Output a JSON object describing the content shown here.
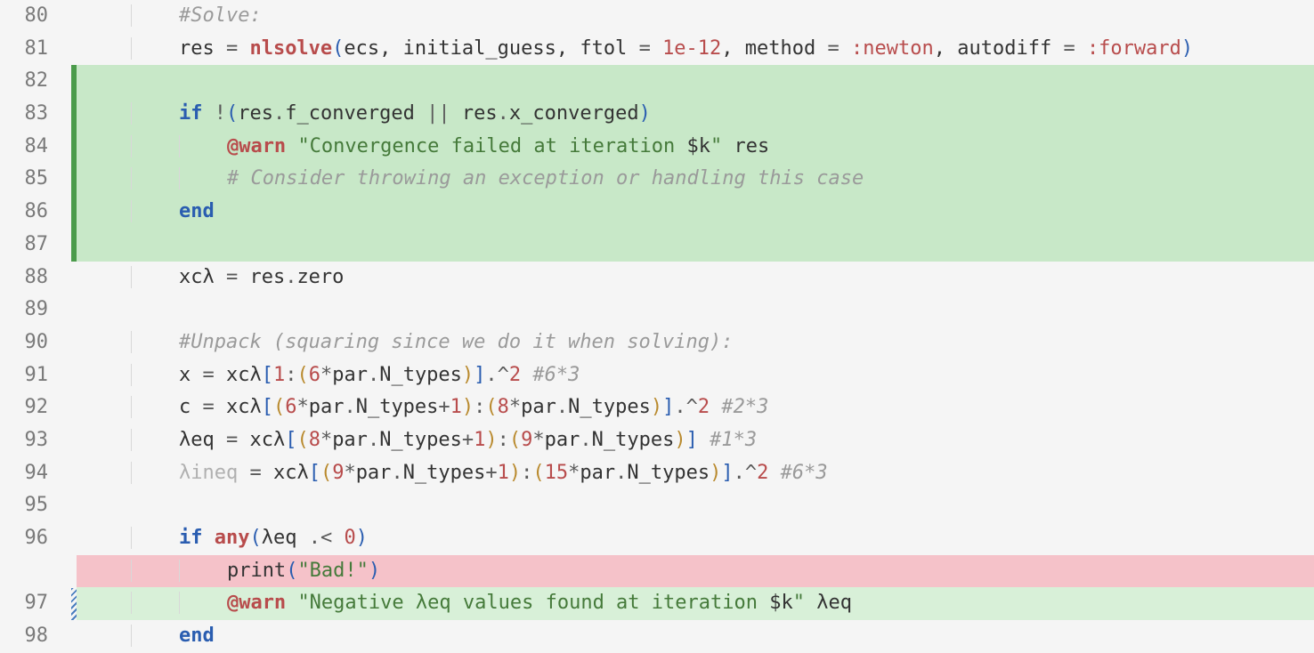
{
  "lines": [
    {
      "num": "80",
      "indent": 2,
      "bg": "",
      "tokens": [
        {
          "t": "#Solve:",
          "c": "c-comment"
        }
      ]
    },
    {
      "num": "81",
      "indent": 2,
      "bg": "",
      "tokens": [
        {
          "t": "res ",
          "c": "c-id"
        },
        {
          "t": "=",
          "c": "c-op"
        },
        {
          "t": " ",
          "c": ""
        },
        {
          "t": "nlsolve",
          "c": "c-fn"
        },
        {
          "t": "(",
          "c": "c-paren"
        },
        {
          "t": "ecs, initial_guess, ftol ",
          "c": "c-id"
        },
        {
          "t": "=",
          "c": "c-op"
        },
        {
          "t": " ",
          "c": ""
        },
        {
          "t": "1e-12",
          "c": "c-num"
        },
        {
          "t": ", method ",
          "c": "c-id"
        },
        {
          "t": "=",
          "c": "c-op"
        },
        {
          "t": " ",
          "c": ""
        },
        {
          "t": ":newton",
          "c": "c-sym"
        },
        {
          "t": ", autodiff ",
          "c": "c-id"
        },
        {
          "t": "=",
          "c": "c-op"
        },
        {
          "t": " ",
          "c": ""
        },
        {
          "t": ":forward",
          "c": "c-sym"
        },
        {
          "t": ")",
          "c": "c-paren"
        }
      ]
    },
    {
      "num": "82",
      "indent": 1,
      "bg": "bg-add",
      "tokens": []
    },
    {
      "num": "83",
      "indent": 2,
      "bg": "bg-add",
      "tokens": [
        {
          "t": "if",
          "c": "c-kw"
        },
        {
          "t": " ",
          "c": ""
        },
        {
          "t": "!",
          "c": "c-op"
        },
        {
          "t": "(",
          "c": "c-paren"
        },
        {
          "t": "res",
          "c": "c-id"
        },
        {
          "t": ".",
          "c": "c-op"
        },
        {
          "t": "f_converged ",
          "c": "c-id"
        },
        {
          "t": "||",
          "c": "c-op"
        },
        {
          "t": " res",
          "c": "c-id"
        },
        {
          "t": ".",
          "c": "c-op"
        },
        {
          "t": "x_converged",
          "c": "c-id"
        },
        {
          "t": ")",
          "c": "c-paren"
        }
      ]
    },
    {
      "num": "84",
      "indent": 3,
      "bg": "bg-add",
      "tokens": [
        {
          "t": "@warn",
          "c": "c-macro"
        },
        {
          "t": " ",
          "c": ""
        },
        {
          "t": "\"Convergence failed at iteration ",
          "c": "c-str"
        },
        {
          "t": "$k",
          "c": "c-id"
        },
        {
          "t": "\"",
          "c": "c-str"
        },
        {
          "t": " res",
          "c": "c-id"
        }
      ]
    },
    {
      "num": "85",
      "indent": 3,
      "bg": "bg-add",
      "tokens": [
        {
          "t": "# Consider throwing an exception or handling this case",
          "c": "c-comment"
        }
      ]
    },
    {
      "num": "86",
      "indent": 2,
      "bg": "bg-add",
      "tokens": [
        {
          "t": "end",
          "c": "c-kw"
        }
      ]
    },
    {
      "num": "87",
      "indent": 1,
      "bg": "bg-add",
      "tokens": []
    },
    {
      "num": "88",
      "indent": 2,
      "bg": "",
      "tokens": [
        {
          "t": "xcλ ",
          "c": "c-id"
        },
        {
          "t": "=",
          "c": "c-op"
        },
        {
          "t": " res",
          "c": "c-id"
        },
        {
          "t": ".",
          "c": "c-op"
        },
        {
          "t": "zero",
          "c": "c-id"
        }
      ]
    },
    {
      "num": "89",
      "indent": 1,
      "bg": "",
      "tokens": []
    },
    {
      "num": "90",
      "indent": 2,
      "bg": "",
      "tokens": [
        {
          "t": "#Unpack (squaring since we do it when solving):",
          "c": "c-comment"
        }
      ]
    },
    {
      "num": "91",
      "indent": 2,
      "bg": "",
      "tokens": [
        {
          "t": "x ",
          "c": "c-id"
        },
        {
          "t": "=",
          "c": "c-op"
        },
        {
          "t": " xcλ",
          "c": "c-id"
        },
        {
          "t": "[",
          "c": "c-paren"
        },
        {
          "t": "1",
          "c": "c-num"
        },
        {
          "t": ":",
          "c": "c-op"
        },
        {
          "t": "(",
          "c": "c-brack-o"
        },
        {
          "t": "6",
          "c": "c-num"
        },
        {
          "t": "*",
          "c": "c-op"
        },
        {
          "t": "par",
          "c": "c-id"
        },
        {
          "t": ".",
          "c": "c-op"
        },
        {
          "t": "N_types",
          "c": "c-id"
        },
        {
          "t": ")",
          "c": "c-brack-o"
        },
        {
          "t": "]",
          "c": "c-paren"
        },
        {
          "t": ".^",
          "c": "c-op"
        },
        {
          "t": "2",
          "c": "c-num"
        },
        {
          "t": " ",
          "c": ""
        },
        {
          "t": "#6*3",
          "c": "c-comment"
        }
      ]
    },
    {
      "num": "92",
      "indent": 2,
      "bg": "",
      "tokens": [
        {
          "t": "c ",
          "c": "c-id"
        },
        {
          "t": "=",
          "c": "c-op"
        },
        {
          "t": " xcλ",
          "c": "c-id"
        },
        {
          "t": "[",
          "c": "c-paren"
        },
        {
          "t": "(",
          "c": "c-brack-o"
        },
        {
          "t": "6",
          "c": "c-num"
        },
        {
          "t": "*",
          "c": "c-op"
        },
        {
          "t": "par",
          "c": "c-id"
        },
        {
          "t": ".",
          "c": "c-op"
        },
        {
          "t": "N_types",
          "c": "c-id"
        },
        {
          "t": "+",
          "c": "c-op"
        },
        {
          "t": "1",
          "c": "c-num"
        },
        {
          "t": ")",
          "c": "c-brack-o"
        },
        {
          "t": ":",
          "c": "c-op"
        },
        {
          "t": "(",
          "c": "c-brack-o"
        },
        {
          "t": "8",
          "c": "c-num"
        },
        {
          "t": "*",
          "c": "c-op"
        },
        {
          "t": "par",
          "c": "c-id"
        },
        {
          "t": ".",
          "c": "c-op"
        },
        {
          "t": "N_types",
          "c": "c-id"
        },
        {
          "t": ")",
          "c": "c-brack-o"
        },
        {
          "t": "]",
          "c": "c-paren"
        },
        {
          "t": ".^",
          "c": "c-op"
        },
        {
          "t": "2",
          "c": "c-num"
        },
        {
          "t": " ",
          "c": ""
        },
        {
          "t": "#2*3",
          "c": "c-comment"
        }
      ]
    },
    {
      "num": "93",
      "indent": 2,
      "bg": "",
      "tokens": [
        {
          "t": "λeq ",
          "c": "c-id"
        },
        {
          "t": "=",
          "c": "c-op"
        },
        {
          "t": " xcλ",
          "c": "c-id"
        },
        {
          "t": "[",
          "c": "c-paren"
        },
        {
          "t": "(",
          "c": "c-brack-o"
        },
        {
          "t": "8",
          "c": "c-num"
        },
        {
          "t": "*",
          "c": "c-op"
        },
        {
          "t": "par",
          "c": "c-id"
        },
        {
          "t": ".",
          "c": "c-op"
        },
        {
          "t": "N_types",
          "c": "c-id"
        },
        {
          "t": "+",
          "c": "c-op"
        },
        {
          "t": "1",
          "c": "c-num"
        },
        {
          "t": ")",
          "c": "c-brack-o"
        },
        {
          "t": ":",
          "c": "c-op"
        },
        {
          "t": "(",
          "c": "c-brack-o"
        },
        {
          "t": "9",
          "c": "c-num"
        },
        {
          "t": "*",
          "c": "c-op"
        },
        {
          "t": "par",
          "c": "c-id"
        },
        {
          "t": ".",
          "c": "c-op"
        },
        {
          "t": "N_types",
          "c": "c-id"
        },
        {
          "t": ")",
          "c": "c-brack-o"
        },
        {
          "t": "]",
          "c": "c-paren"
        },
        {
          "t": " ",
          "c": ""
        },
        {
          "t": "#1*3",
          "c": "c-comment"
        }
      ]
    },
    {
      "num": "94",
      "indent": 2,
      "bg": "",
      "tokens": [
        {
          "t": "λineq ",
          "c": "c-faded"
        },
        {
          "t": "=",
          "c": "c-op"
        },
        {
          "t": " xcλ",
          "c": "c-id"
        },
        {
          "t": "[",
          "c": "c-paren"
        },
        {
          "t": "(",
          "c": "c-brack-o"
        },
        {
          "t": "9",
          "c": "c-num"
        },
        {
          "t": "*",
          "c": "c-op"
        },
        {
          "t": "par",
          "c": "c-id"
        },
        {
          "t": ".",
          "c": "c-op"
        },
        {
          "t": "N_types",
          "c": "c-id"
        },
        {
          "t": "+",
          "c": "c-op"
        },
        {
          "t": "1",
          "c": "c-num"
        },
        {
          "t": ")",
          "c": "c-brack-o"
        },
        {
          "t": ":",
          "c": "c-op"
        },
        {
          "t": "(",
          "c": "c-brack-o"
        },
        {
          "t": "15",
          "c": "c-num"
        },
        {
          "t": "*",
          "c": "c-op"
        },
        {
          "t": "par",
          "c": "c-id"
        },
        {
          "t": ".",
          "c": "c-op"
        },
        {
          "t": "N_types",
          "c": "c-id"
        },
        {
          "t": ")",
          "c": "c-brack-o"
        },
        {
          "t": "]",
          "c": "c-paren"
        },
        {
          "t": ".^",
          "c": "c-op"
        },
        {
          "t": "2",
          "c": "c-num"
        },
        {
          "t": " ",
          "c": ""
        },
        {
          "t": "#6*3",
          "c": "c-comment"
        }
      ]
    },
    {
      "num": "95",
      "indent": 1,
      "bg": "",
      "tokens": []
    },
    {
      "num": "96",
      "indent": 2,
      "bg": "",
      "tokens": [
        {
          "t": "if",
          "c": "c-kw"
        },
        {
          "t": " ",
          "c": ""
        },
        {
          "t": "any",
          "c": "c-fn"
        },
        {
          "t": "(",
          "c": "c-paren"
        },
        {
          "t": "λeq ",
          "c": "c-id"
        },
        {
          "t": ".<",
          "c": "c-op"
        },
        {
          "t": " ",
          "c": ""
        },
        {
          "t": "0",
          "c": "c-num"
        },
        {
          "t": ")",
          "c": "c-paren"
        }
      ]
    },
    {
      "num": "",
      "indent": 3,
      "bg": "bg-del",
      "tokens": [
        {
          "t": "print",
          "c": "c-id"
        },
        {
          "t": "(",
          "c": "c-paren"
        },
        {
          "t": "\"Bad!\"",
          "c": "c-str"
        },
        {
          "t": ")",
          "c": "c-paren"
        }
      ]
    },
    {
      "num": "97",
      "indent": 3,
      "bg": "bg-add-light",
      "tokens": [
        {
          "t": "@warn",
          "c": "c-macro"
        },
        {
          "t": " ",
          "c": ""
        },
        {
          "t": "\"Negative λeq values found at iteration ",
          "c": "c-str"
        },
        {
          "t": "$k",
          "c": "c-id"
        },
        {
          "t": "\"",
          "c": "c-str"
        },
        {
          "t": " λeq",
          "c": "c-id"
        }
      ]
    },
    {
      "num": "98",
      "indent": 2,
      "bg": "",
      "tokens": [
        {
          "t": "end",
          "c": "c-kw"
        }
      ]
    }
  ],
  "markers": [
    {
      "start": 2,
      "end": 8,
      "class": "marker-green"
    },
    {
      "start": 18,
      "end": 19,
      "class": "marker-hatch"
    }
  ],
  "indent_width": 4,
  "base_indent": "    "
}
